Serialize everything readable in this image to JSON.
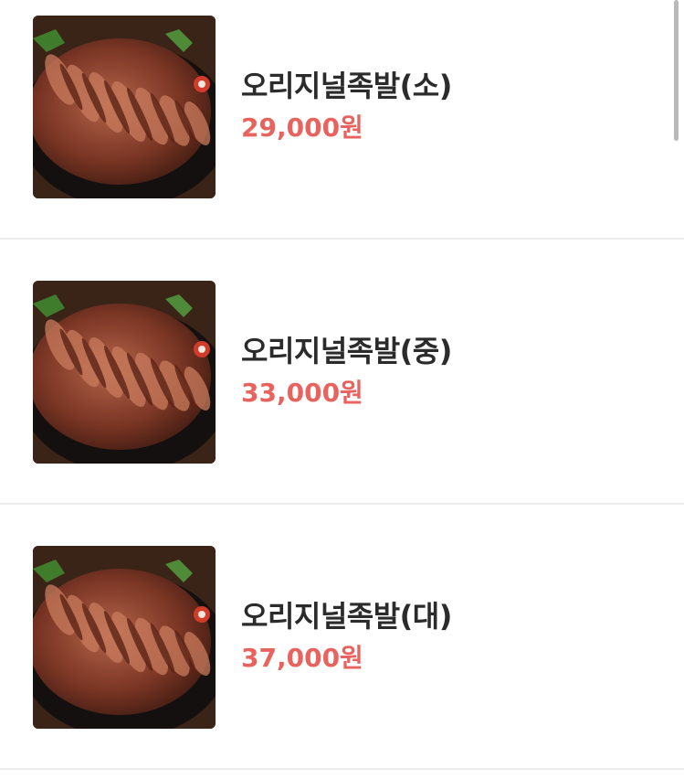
{
  "menu": {
    "items": [
      {
        "name": "오리지널족발(소)",
        "price": "29,000원"
      },
      {
        "name": "오리지널족발(중)",
        "price": "33,000원"
      },
      {
        "name": "오리지널족발(대)",
        "price": "37,000원"
      }
    ]
  },
  "colors": {
    "price": "#e8625e",
    "name": "#2b2b2b",
    "divider": "#ececec"
  },
  "icons": {
    "thumbnail": "jokbal-food-photo"
  }
}
